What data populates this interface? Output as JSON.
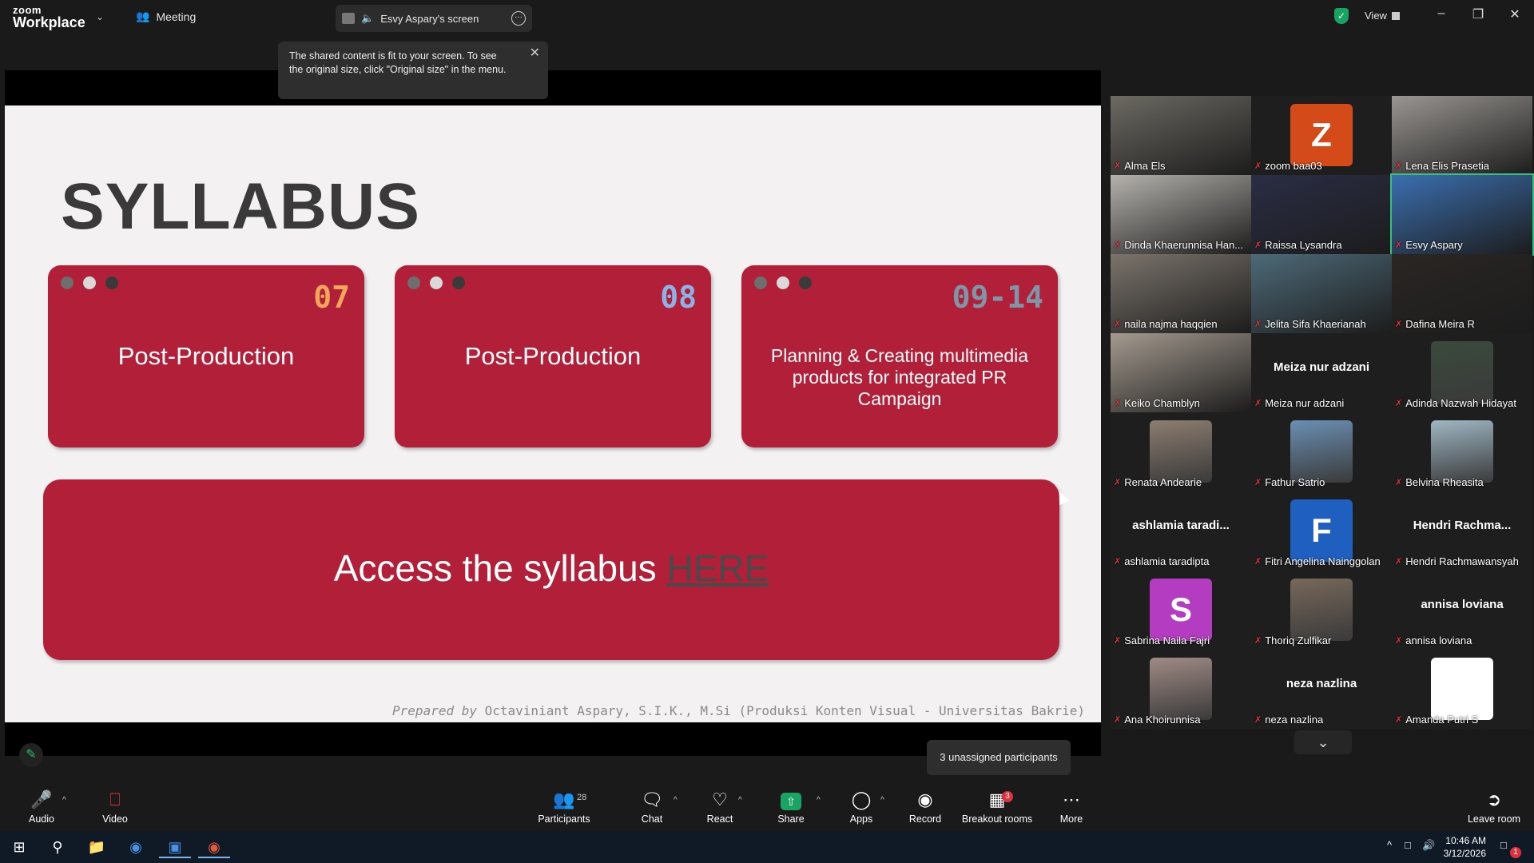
{
  "topbar": {
    "logo_line1": "zoom",
    "logo_line2": "Workplace",
    "meeting_label": "Meeting",
    "screen_label": "Esvy Aspary's screen",
    "view_label": "View"
  },
  "notice": {
    "text": "The shared content is fit to your screen. To see the original size, click \"Original size\" in the menu."
  },
  "slide": {
    "title": "SYLLABUS",
    "cards": [
      {
        "num": "07",
        "num_color": "#f2a65a",
        "text": "Post-Production"
      },
      {
        "num": "08",
        "num_color": "#8ab4e8",
        "text": "Post-Production"
      },
      {
        "num": "09-14",
        "num_color": "#7e97a8",
        "text": "Planning & Creating  multimedia products for integrated PR Campaign"
      }
    ],
    "access_text": "Access the syllabus ",
    "access_link": "HERE",
    "prepared_by": "Prepared by",
    "prepared_rest": " Octaviniant Aspary, S.I.K., M.Si (Produksi Konten Visual - Universitas Bakrie)"
  },
  "participants": [
    {
      "name": "Alma Els",
      "type": "video",
      "color": "#6d6a63"
    },
    {
      "name": "zoom baa03",
      "type": "letter",
      "letter": "Z",
      "color": "#d44a18"
    },
    {
      "name": "Lena Elis Prasetia",
      "type": "video",
      "color": "#9a9692"
    },
    {
      "name": "Dinda Khaerunnisa Han...",
      "type": "video",
      "color": "#b5b2ad"
    },
    {
      "name": "Raissa Lysandra",
      "type": "video",
      "color": "#2a2d45"
    },
    {
      "name": "Esvy Aspary",
      "type": "video",
      "color": "#3b6fb0",
      "active": true
    },
    {
      "name": "naila najma haqqien",
      "type": "video",
      "color": "#7b746c"
    },
    {
      "name": "Jelita Sifa Khaerianah",
      "type": "video",
      "color": "#4d6a78"
    },
    {
      "name": "Dafina Meira R",
      "type": "video",
      "color": "#2a2624"
    },
    {
      "name": "Keiko Chamblyn",
      "type": "video",
      "color": "#a49a8f"
    },
    {
      "name": "Meiza nur adzani",
      "type": "text",
      "display": "Meiza nur adzani"
    },
    {
      "name": "Adinda Nazwah Hidayat",
      "type": "pic",
      "color": "#3a4a3c"
    },
    {
      "name": "Renata Andearie",
      "type": "pic",
      "color": "#8c7d70"
    },
    {
      "name": "Fathur Satrio",
      "type": "pic",
      "color": "#6a8fb3"
    },
    {
      "name": "Belvina Rheasita",
      "type": "pic",
      "color": "#9fb6c4"
    },
    {
      "name": "ashlamia taradipta",
      "type": "text",
      "display": "ashlamia  taradi..."
    },
    {
      "name": "Fitri Angelina Nainggolan",
      "type": "letter",
      "letter": "F",
      "color": "#1f5fbf"
    },
    {
      "name": "Hendri Rachmawansyah",
      "type": "text",
      "display": "Hendri  Rachma..."
    },
    {
      "name": "Sabrina Naila Fajri",
      "type": "letter",
      "letter": "S",
      "color": "#b43cc0"
    },
    {
      "name": "Thoriq Zulfikar",
      "type": "pic",
      "color": "#77685a"
    },
    {
      "name": "annisa loviana",
      "type": "text",
      "display": "annisa loviana"
    },
    {
      "name": "Ana Khoirunnisa",
      "type": "pic",
      "color": "#a08a85"
    },
    {
      "name": "neza nazlina",
      "type": "text",
      "display": "neza nazlina"
    },
    {
      "name": "Amanda Putri S",
      "type": "pic",
      "color": "#ffffff"
    }
  ],
  "unassigned_text": "3 unassigned participants",
  "toolbar": {
    "audio": "Audio",
    "video": "Video",
    "participants": "Participants",
    "participants_count": "28",
    "chat": "Chat",
    "react": "React",
    "share": "Share",
    "apps": "Apps",
    "record": "Record",
    "breakout": "Breakout rooms",
    "breakout_badge": "3",
    "more": "More",
    "leave": "Leave room"
  },
  "taskbar": {
    "time": "10:46 AM",
    "date": "3/12/2026",
    "notif_count": "1"
  }
}
